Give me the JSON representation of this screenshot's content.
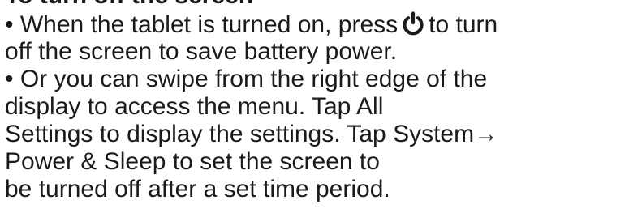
{
  "heading": "To turn off the screen",
  "bullet_symbol": "•",
  "paragraph1": {
    "line1_before_icon": "When the tablet is turned on, press",
    "icon": "power-icon",
    "line1_after_icon": "to turn",
    "line2": "off the screen to save battery power."
  },
  "paragraph2": {
    "line1": "Or you can swipe from the right edge of the",
    "line2": "display to access the menu. Tap All",
    "line3": "Settings to display the settings. Tap System→",
    "line4": "Power & Sleep to set the screen to",
    "line5": "be turned off after a set time period."
  }
}
